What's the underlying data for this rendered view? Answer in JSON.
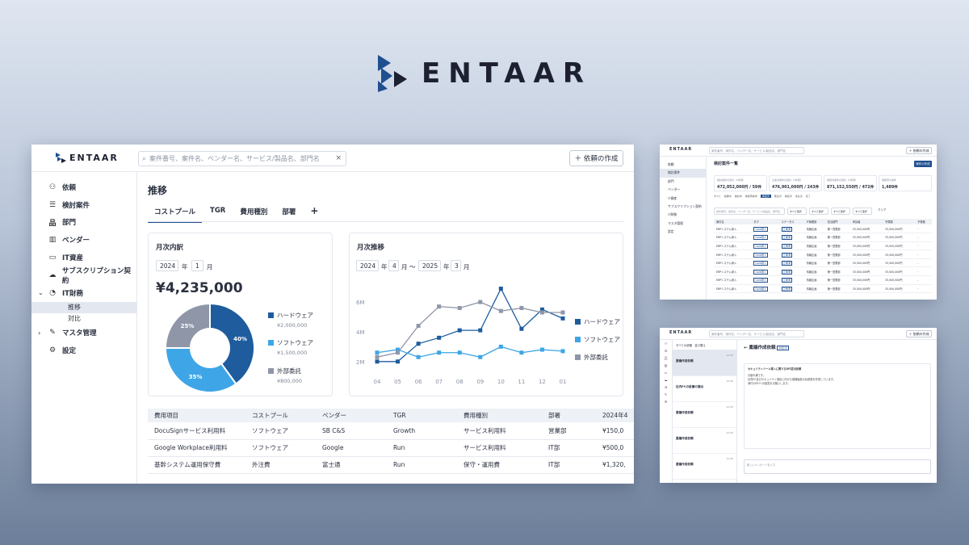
{
  "brand": {
    "name": "ENTAAR",
    "accent": "#1f4f8f",
    "dark": "#1d2030"
  },
  "main": {
    "topbar": {
      "search_placeholder": "案件番号、案件名、ベンダー名、サービス/製品名、部門名",
      "clear_icon": "×",
      "create_button": "＋ 依頼の作成"
    },
    "sidebar": {
      "items": [
        {
          "label": "依頼",
          "icon": "users-icon"
        },
        {
          "label": "検討案件",
          "icon": "list-icon"
        },
        {
          "label": "部門",
          "icon": "org-icon"
        },
        {
          "label": "ベンダー",
          "icon": "building-icon"
        },
        {
          "label": "IT資産",
          "icon": "monitor-icon"
        },
        {
          "label": "サブスクリプション契約",
          "icon": "cloud-icon"
        },
        {
          "label": "IT財務",
          "icon": "pie-icon"
        },
        {
          "label": "マスタ管理",
          "icon": "wrench-icon"
        },
        {
          "label": "設定",
          "icon": "gear-icon"
        }
      ],
      "subitems": [
        "推移",
        "対比"
      ]
    },
    "page_title": "推移",
    "tabs": [
      "コストプール",
      "TGR",
      "費用種別",
      "部署"
    ],
    "tab_add": "+",
    "monthly_breakdown": {
      "title": "月次内訳",
      "year": "2024",
      "year_unit": "年",
      "month": "1",
      "month_unit": "月",
      "total": "¥4,235,000",
      "legend": [
        {
          "name": "ハードウェア",
          "value": "¥2,000,000",
          "color": "#1f5c9e"
        },
        {
          "name": "ソフトウェア",
          "value": "¥1,500,000",
          "color": "#3ea6e6"
        },
        {
          "name": "外部委託",
          "value": "¥800,000",
          "color": "#8e96a8"
        }
      ]
    },
    "monthly_trend": {
      "title": "月次推移",
      "from_year": "2024",
      "from_month": "4",
      "to_year": "2025",
      "to_month": "3",
      "year_unit": "年",
      "month_unit": "月",
      "tilde": "〜"
    },
    "table": {
      "headers": [
        "費用項目",
        "コストプール",
        "ベンダー",
        "TGR",
        "費用種別",
        "部署",
        "2024年4"
      ],
      "rows": [
        [
          "DocuSignサービス利用料",
          "ソフトウェア",
          "SB C&S",
          "Growth",
          "サービス利用料",
          "営業部",
          "¥150,0"
        ],
        [
          "Google Workplace利用料",
          "ソフトウェア",
          "Google",
          "Run",
          "サービス利用料",
          "IT部",
          "¥500,0"
        ],
        [
          "基幹システム運用保守費",
          "外注費",
          "富士通",
          "Run",
          "保守・運用費",
          "IT部",
          "¥1,320,"
        ]
      ]
    }
  },
  "chart_data": [
    {
      "type": "pie",
      "title": "月次内訳",
      "labels": [
        "ハードウェア",
        "ソフトウェア",
        "外部委託"
      ],
      "values": [
        40,
        35,
        25
      ],
      "value_labels": [
        "40%",
        "35%",
        "25%"
      ],
      "colors": [
        "#1f5c9e",
        "#3ea6e6",
        "#8e96a8"
      ],
      "legend": "right"
    },
    {
      "type": "line",
      "title": "月次推移",
      "categories": [
        "04",
        "05",
        "06",
        "07",
        "08",
        "09",
        "10",
        "11",
        "12",
        "01"
      ],
      "yticks": [
        "2M",
        "4M",
        "6M"
      ],
      "ylim": [
        1.5,
        7.2
      ],
      "legend": "right",
      "series": [
        {
          "name": "ハードウェア",
          "color": "#1f5c9e",
          "values": [
            2.0,
            2.0,
            3.2,
            3.6,
            4.1,
            4.1,
            6.9,
            4.2,
            5.5,
            4.9
          ]
        },
        {
          "name": "ソフトウェア",
          "color": "#3ea6e6",
          "values": [
            2.6,
            2.8,
            2.3,
            2.6,
            2.6,
            2.3,
            3.0,
            2.6,
            2.8,
            2.7
          ]
        },
        {
          "name": "外部委託",
          "color": "#8e96a8",
          "values": [
            2.3,
            2.6,
            4.4,
            5.7,
            5.6,
            6.0,
            5.4,
            5.6,
            5.3,
            5.3
          ]
        }
      ]
    }
  ],
  "screen_list": {
    "title": "検討案件一覧",
    "search_placeholder": "案件番号、案件名、ベンダー名、サービス/製品名、部門名",
    "create_button": "＋ 依頼の作成",
    "export_button": "案件の作成",
    "sidebar": [
      "依頼",
      "検討案件",
      "部門",
      "ベンダー",
      "IT資産",
      "サブスクリプション契約",
      "IT財務",
      "マスタ管理",
      "設定"
    ],
    "kpis": [
      {
        "label": "検討案件の合計（1年間）",
        "value": "472,052,000円 / 59件"
      },
      {
        "label": "立案済案件の合計（1年間）",
        "value": "476,901,000円 / 243件"
      },
      {
        "label": "承認済案件の合計（1年間）",
        "value": "871,152,550円 / 472件"
      },
      {
        "label": "承認待ち案件",
        "value": "1,489件"
      }
    ],
    "chips": [
      "すべて",
      "依頼中",
      "検討中",
      "承認申請中",
      "承認済",
      "発注済",
      "検収済",
      "支払済",
      "完了"
    ],
    "filter_placeholder": "案件番号、案件名、ベンダー名、サービス/製品名、部門名",
    "filter_select": "すべて選択",
    "clear_label": "クリア",
    "headers": [
      "案件名",
      "タグ",
      "ステータス",
      "IT管理部",
      "担当部門",
      "申請者",
      "予算額",
      "発注額",
      "予算差"
    ],
    "row": [
      "ERPシステム導入",
      "Gold導入",
      "立案済",
      "情報企画",
      "第一営業部",
      "33,500,000円",
      "33,500,000円",
      "-"
    ]
  },
  "screen_chat": {
    "title": "稟議作成依頼",
    "status": "対応中",
    "list_filter": "すべての依頼",
    "list_sort": "並び替え",
    "list_items": [
      {
        "time": "12:45",
        "name": "稟議作成依頼"
      },
      {
        "time": "12:45",
        "name": "社内PCの設備の貸出"
      },
      {
        "time": "12:45",
        "name": "稟議作成依頼"
      },
      {
        "time": "12:45",
        "name": "稟議作成依頼"
      },
      {
        "time": "12:45",
        "name": "稟議作成依頼"
      }
    ],
    "message_heading": "セキュリティツール導入に関するRFI提出依頼",
    "message_body": "お疲れ様です。\n社内PC及びセキュリティ強化に向けた候補製品の比較表を作成しています。\n添付のRFIへの回答をお願いします。",
    "input_placeholder": "新しいメッセージを入力"
  }
}
